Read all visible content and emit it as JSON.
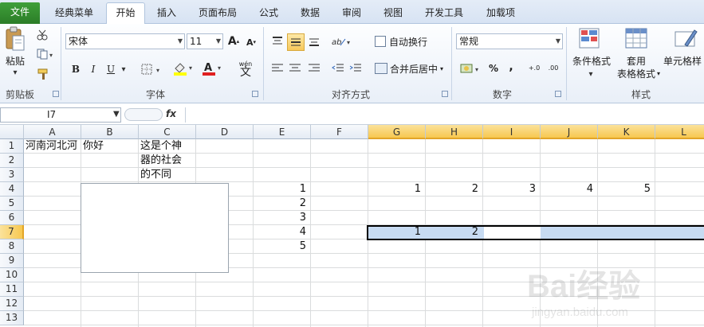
{
  "tabs": {
    "file": "文件",
    "classic": "经典菜单",
    "home": "开始",
    "insert": "插入",
    "layout": "页面布局",
    "formulas": "公式",
    "data": "数据",
    "review": "审阅",
    "view": "视图",
    "developer": "开发工具",
    "addins": "加载项"
  },
  "clipboard": {
    "paste": "粘贴",
    "label": "剪贴板"
  },
  "font": {
    "name": "宋体",
    "size": "11",
    "bold": "B",
    "italic": "I",
    "underline": "U",
    "label": "字体",
    "wen": "wén",
    "wenchar": "文"
  },
  "alignment": {
    "wrap": "自动换行",
    "merge": "合并后居中",
    "label": "对齐方式"
  },
  "number": {
    "format": "常规",
    "percent": "%",
    "comma": ",",
    "inc": "+.0",
    "dec": ".00",
    "label": "数字"
  },
  "styles": {
    "cond": "条件格式",
    "table1": "套用",
    "table2": "表格格式",
    "cell": "单元格样",
    "label": "样式"
  },
  "formula_bar": {
    "namebox": "I7",
    "fx": "fx",
    "value": ""
  },
  "columns": [
    "A",
    "B",
    "C",
    "D",
    "E",
    "F",
    "G",
    "H",
    "I",
    "J",
    "K",
    "L"
  ],
  "rows": [
    "1",
    "2",
    "3",
    "4",
    "5",
    "6",
    "7",
    "8",
    "9",
    "10",
    "11",
    "12",
    "13"
  ],
  "cells": {
    "a1": "河南河北河",
    "b1": "你好",
    "c1": "这是个神",
    "c2": "器的社会",
    "c3": "的不同",
    "e4": "1",
    "e5": "2",
    "e6": "3",
    "e7": "4",
    "e8": "5",
    "g4": "1",
    "h4": "2",
    "i4": "3",
    "j4": "4",
    "k4": "5",
    "g7": "1",
    "h7": "2"
  },
  "watermark": {
    "brand": "Bai经验",
    "url": "jingyan.baidu.com"
  }
}
